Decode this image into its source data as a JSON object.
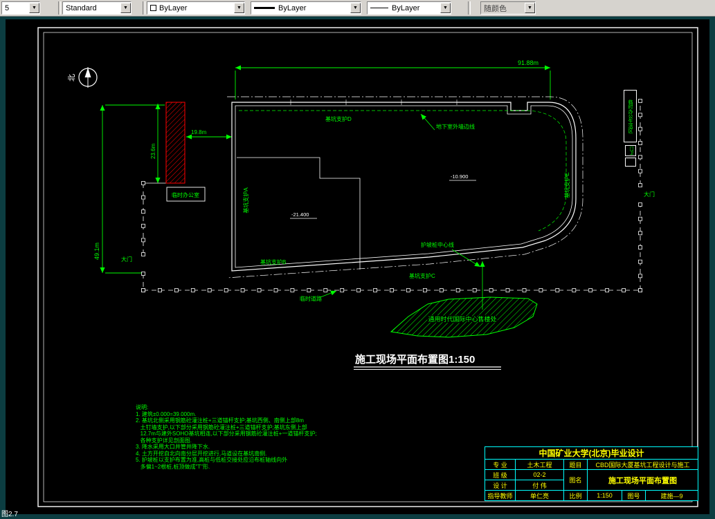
{
  "toolbar": {
    "combos": {
      "partial": "5",
      "text_style": "Standard",
      "color": "ByLayer",
      "lineweight": "ByLayer",
      "linetype": "ByLayer",
      "plot_style": "随颜色"
    }
  },
  "drawing": {
    "north_label": "北",
    "dimensions": {
      "top": "91.88m",
      "left": "49.1m",
      "office_width": "19.8m",
      "office_height": "23.6m"
    },
    "elevations": {
      "deep": "-21.400",
      "shallow": "-10.900"
    },
    "labels": {
      "support_a": "基坑支护A",
      "support_b": "基坑支护B",
      "support_c": "基坑支护C",
      "support_d": "基坑支护D",
      "support_e": "基坑支护E",
      "basement_wall": "地下室外墙边线",
      "pile_centerline": "护坡桩中心线",
      "temp_road": "临时道路",
      "temp_office": "临时办公室",
      "gate_left": "大门",
      "gate_right": "大门",
      "office_area": "临时办公生活区",
      "guard": "门卫",
      "sales_center": "通用时代国际中心售楼处"
    },
    "title": "施工现场平面布置图1:150",
    "notes": [
      "说明:",
      "1. 建筑±0.000=39.000m.",
      "2. 基坑北侧采用钢筋砼灌注桩+三道锚杆支护;基坑西侧、南侧上部8m",
      "   土钉墙支护,以下部分采用钢筋砼灌注桩+三道锚杆支护;基坑东侧上部",
      "   12.7m与建外SOHO基坑相连,以下部分采用钢筋砼灌注桩+一道锚杆支护;",
      "   各种支护详见剖面图.",
      "3. 降水采用大口井管井降下水.",
      "4. 土方开挖自北向南分层开挖进行,马道设在基坑南侧.",
      "5. 护坡桩以支护布置为准,高桩与低桩交接处应沿布桩轴线向外",
      "   多偏1~2根桩,桩顶做成\"T\"形."
    ],
    "titleblock": {
      "university": "中国矿业大学(北京)毕业设计",
      "major_label": "专  业",
      "major": "土木工程",
      "subject_label": "题目",
      "subject": "CBD国际大厦基坑工程设计与施工",
      "class_label": "班  级",
      "class": "02-2",
      "name_label": "图名",
      "name": "施工现场平面布置图",
      "designer_label": "设  计",
      "designer": "付 伟",
      "advisor_label": "指导教师",
      "advisor": "单仁亮",
      "scale_label": "比例",
      "scale": "1:150",
      "number_label": "图号",
      "number": "建施—9"
    }
  },
  "statusbar": {
    "figure_caption": "图2.7"
  }
}
